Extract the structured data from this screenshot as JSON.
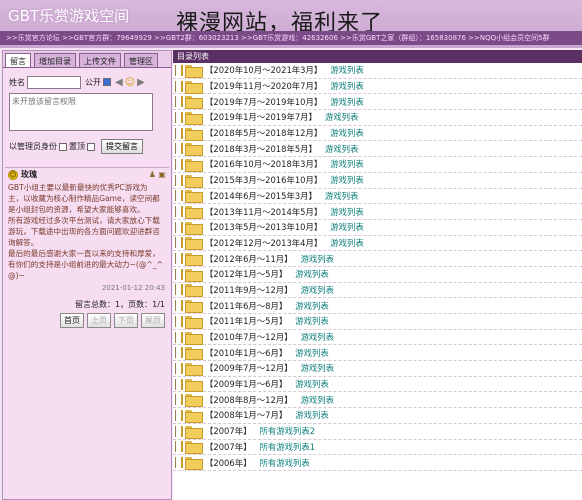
{
  "header": {
    "site_title": "GBT乐赏游戏空间",
    "overlay_caption": "裸漫网站，福利来了",
    "ticker": ">>乐赏官方论坛 >>GBT官方群：79649929 >>GBT2群：603023213 >>GBT乐赏游戏：42632606 >>乐赏GBT之家（群组）：165830876 >>NQQ小组会员空间5群"
  },
  "left": {
    "tabs": [
      "留言",
      "增加目录",
      "上传文件",
      "管理区"
    ],
    "form": {
      "name_label": "姓名",
      "public_label": "公开",
      "message_placeholder": "未开放该留言权限",
      "admin_label": "以管理员身份",
      "pin_label": "置顶",
      "submit_label": "提交留言"
    },
    "notice": {
      "author": "玫瑰",
      "lines": [
        "GBT小组主要以最新最快的优秀PC游戏为",
        "主，以收藏为核心制作精品Game，读空间都",
        "是小组封包的资源，希望大家能够喜欢。",
        "所有游戏经过多次平台测试，请大家放心下载",
        "游玩，下载途中出现的各方面问题欢迎进群咨",
        "询解答。",
        "最后的最后感谢大家一直以来的支持和厚爱，",
        "有你们的支持是小组前进的最大动力~(@^_^",
        "@)~"
      ],
      "date": "2021-01-12 20:43",
      "stats": "留言总数：1，页数：1/1"
    },
    "pager": [
      "首页",
      "上页",
      "下页",
      "尾页"
    ]
  },
  "right": {
    "header": "目录列表",
    "rows": [
      {
        "date": "【2020年10月～2021年3月】",
        "link": "游戏列表"
      },
      {
        "date": "【2019年11月～2020年7月】",
        "link": "游戏列表"
      },
      {
        "date": "【2019年7月～2019年10月】",
        "link": "游戏列表"
      },
      {
        "date": "【2019年1月～2019年7月】",
        "link": "游戏列表"
      },
      {
        "date": "【2018年5月～2018年12月】",
        "link": "游戏列表"
      },
      {
        "date": "【2018年3月～2018年5月】",
        "link": "游戏列表"
      },
      {
        "date": "【2016年10月～2018年3月】",
        "link": "游戏列表"
      },
      {
        "date": "【2015年3月～2016年10月】",
        "link": "游戏列表"
      },
      {
        "date": "【2014年6月～2015年3月】",
        "link": "游戏列表"
      },
      {
        "date": "【2013年11月～2014年5月】",
        "link": "游戏列表"
      },
      {
        "date": "【2013年5月～2013年10月】",
        "link": "游戏列表"
      },
      {
        "date": "【2012年12月～2013年4月】",
        "link": "游戏列表"
      },
      {
        "date": "【2012年6月～11月】",
        "link": "游戏列表"
      },
      {
        "date": "【2012年1月～5月】",
        "link": "游戏列表"
      },
      {
        "date": "【2011年9月～12月】",
        "link": "游戏列表"
      },
      {
        "date": "【2011年6月～8月】",
        "link": "游戏列表"
      },
      {
        "date": "【2011年1月～5月】",
        "link": "游戏列表"
      },
      {
        "date": "【2010年7月～12月】",
        "link": "游戏列表"
      },
      {
        "date": "【2010年1月～6月】",
        "link": "游戏列表"
      },
      {
        "date": "【2009年7月～12月】",
        "link": "游戏列表"
      },
      {
        "date": "【2009年1月～6月】",
        "link": "游戏列表"
      },
      {
        "date": "【2008年8月～12月】",
        "link": "游戏列表"
      },
      {
        "date": "【2008年1月～7月】",
        "link": "游戏列表"
      },
      {
        "date": "【2007年】",
        "link": "所有游戏列表2"
      },
      {
        "date": "【2007年】",
        "link": "所有游戏列表1"
      },
      {
        "date": "【2006年】",
        "link": "所有游戏列表"
      }
    ]
  }
}
